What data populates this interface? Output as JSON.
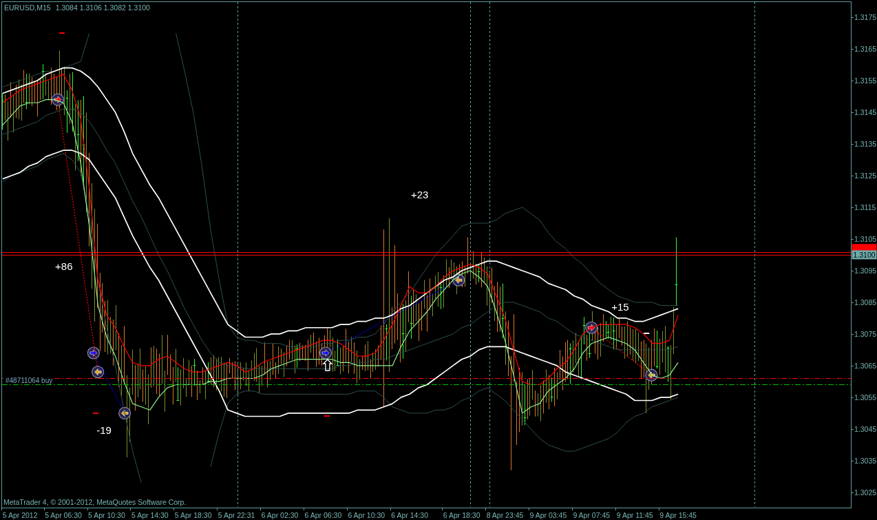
{
  "chart": {
    "symbol": "EURUSD,M15",
    "quotes": "1.3084 1.3106 1.3082 1.3100",
    "price_tag": "1.3100",
    "copyright": "MetaTrader 4, © 2001-2012, MetaQuotes Software Corp.",
    "chart_data": {
      "type": "line",
      "categories": [
        null,
        null,
        "5 Apr 2012",
        null,
        null,
        null,
        null,
        "5 Apr 06:30",
        null,
        null,
        null,
        null,
        "5 Apr 10:30",
        null,
        null,
        null,
        null,
        "5 Apr 14:30",
        null,
        null,
        null,
        null,
        "5 Apr 18:30",
        null,
        null,
        null,
        null,
        "5 Apr 22:31",
        null,
        null,
        null,
        null,
        "6 Apr 02:30",
        null,
        null,
        null,
        null,
        "6 Apr 06:30",
        null,
        null,
        null,
        null,
        "6 Apr 10:30",
        null,
        null,
        null,
        null,
        "6 Apr 14:30",
        null,
        null,
        null,
        null,
        null,
        "6 Apr 18:30",
        null,
        null,
        null,
        null,
        "8 Apr 23:45",
        null,
        null,
        null,
        null,
        "9 Apr 03:45",
        null,
        null,
        null,
        null,
        "9 Apr 07:45",
        null,
        null,
        null,
        null,
        "9 Apr 11:45",
        null,
        null,
        null,
        null,
        "9 Apr 15:45"
      ],
      "ylim": [
        1.30204,
        1.31798
      ],
      "yticks": [
        {
          "value": 1.3175,
          "label": "1.3175"
        },
        {
          "value": 1.3165,
          "label": "1.3165"
        },
        {
          "value": 1.3155,
          "label": "1.3155"
        },
        {
          "value": 1.3145,
          "label": "1.3145"
        },
        {
          "value": 1.3135,
          "label": "1.3135"
        },
        {
          "value": 1.3125,
          "label": "1.3125"
        },
        {
          "value": 1.3115,
          "label": "1.3115"
        },
        {
          "value": 1.3105,
          "label": "1.3105"
        },
        {
          "value": 1.3095,
          "label": "1.3095"
        },
        {
          "value": 1.3085,
          "label": "1.3085"
        },
        {
          "value": 1.3075,
          "label": "1.3075"
        },
        {
          "value": 1.3065,
          "label": "1.3065"
        },
        {
          "value": 1.3055,
          "label": "1.3055"
        },
        {
          "value": 1.3045,
          "label": "1.3045"
        },
        {
          "value": 1.3035,
          "label": "1.3035"
        },
        {
          "value": 1.3025,
          "label": "1.3025"
        }
      ],
      "series": [
        {
          "color": "#2f4f4f",
          "values": [
            1.3153,
            1.3154,
            1.3155,
            1.3156,
            1.3157,
            1.3158,
            1.3158,
            1.3159,
            1.316,
            1.3161,
            1.317,
            null,
            null,
            null,
            null,
            null,
            null,
            null,
            null,
            null,
            1.317,
            1.3158,
            1.3145,
            1.3128,
            1.3108,
            1.3092,
            1.3078,
            1.3074,
            1.3073,
            1.3073,
            1.3072,
            1.3072,
            1.3072,
            1.3071,
            1.3071,
            1.3071,
            1.3071,
            1.3072,
            1.3072,
            1.3073,
            1.3073,
            1.3074,
            1.3074,
            1.3075,
            1.3078,
            1.3082,
            1.3085,
            1.3088,
            1.3092,
            1.3096,
            1.31,
            1.3103,
            1.3106,
            1.3109,
            1.311,
            1.311,
            1.311,
            1.3111,
            1.3113,
            1.3114,
            1.3115,
            1.3113,
            1.3111,
            1.3107,
            1.3104,
            1.3102,
            1.3099,
            1.3097,
            1.3094,
            1.3091,
            1.3089,
            1.3087,
            1.3086,
            1.3085,
            1.3085,
            1.3085,
            1.3084,
            1.3084,
            1.3084
          ]
        },
        {
          "color": "#2f4f4f",
          "values": [
            1.3138,
            1.3139,
            1.314,
            1.3141,
            1.3142,
            1.3144,
            1.3145,
            1.3146,
            1.3146,
            1.3145,
            1.3142,
            1.3138,
            1.3133,
            1.3129,
            1.3123,
            1.3117,
            1.3112,
            1.3106,
            1.31,
            1.3095,
            1.3089,
            1.3083,
            1.3078,
            1.3073,
            1.3069,
            1.3066,
            1.3065,
            1.3065,
            1.3064,
            1.3064,
            1.3064,
            1.3064,
            1.3064,
            1.3064,
            1.3064,
            1.3064,
            1.3064,
            1.3064,
            1.3064,
            1.3065,
            1.3065,
            1.3066,
            1.3066,
            1.3067,
            1.3067,
            1.3068,
            1.3069,
            1.307,
            1.3071,
            1.3072,
            1.3073,
            1.3074,
            1.3075,
            1.3077,
            1.3078,
            1.308,
            1.3082,
            1.3084,
            1.3085,
            1.3085,
            1.3084,
            1.3083,
            1.3082,
            1.308,
            1.3079,
            1.3077,
            1.3075,
            1.3074,
            1.3073,
            1.3072,
            1.3071,
            1.307,
            1.307,
            1.307,
            1.307,
            1.307,
            1.307,
            1.307,
            1.3071
          ]
        },
        {
          "color": "#2f4f4f",
          "values": [
            1.3123,
            1.3125,
            1.3126,
            1.3127,
            1.3128,
            1.313,
            1.3131,
            1.3132,
            1.313,
            1.3126,
            1.3112,
            1.3092,
            1.3077,
            1.3065,
            1.3051,
            1.3038,
            1.3028,
            null,
            null,
            null,
            null,
            null,
            null,
            null,
            1.3033,
            1.3044,
            1.3053,
            1.3056,
            1.3057,
            1.3057,
            1.3056,
            1.3056,
            1.3056,
            1.3056,
            1.3056,
            1.3056,
            1.3056,
            1.3056,
            1.3056,
            1.3056,
            1.3056,
            1.3057,
            1.3057,
            1.3057,
            1.3055,
            1.3052,
            1.3051,
            1.305,
            1.305,
            1.305,
            1.3051,
            1.3051,
            1.3052,
            1.3054,
            1.3055,
            1.3057,
            1.3058,
            1.3056,
            1.3054,
            1.3051,
            1.3048,
            1.3045,
            1.3042,
            1.304,
            1.3039,
            1.3038,
            1.3038,
            1.3039,
            1.304,
            1.3041,
            1.3042,
            1.3044,
            1.3047,
            1.3049,
            1.305,
            1.3052,
            1.3053,
            1.3054,
            1.3055
          ]
        },
        {
          "color": "#ffffff",
          "values": [
            1.3151,
            1.3152,
            1.3153,
            1.3154,
            1.3155,
            1.3157,
            1.3158,
            1.3159,
            1.3159,
            1.3158,
            1.3156,
            1.3153,
            1.3149,
            1.3145,
            1.3139,
            1.3132,
            1.3127,
            1.3122,
            1.3118,
            1.3113,
            1.3108,
            1.3103,
            1.3098,
            1.3093,
            1.3088,
            1.3083,
            1.3078,
            1.3076,
            1.3074,
            1.3074,
            1.3074,
            1.3075,
            1.3075,
            1.3076,
            1.3076,
            1.3077,
            1.3077,
            1.3077,
            1.3077,
            1.3078,
            1.3078,
            1.3079,
            1.3079,
            1.308,
            1.308,
            1.3081,
            1.3083,
            1.3084,
            1.3086,
            1.3088,
            1.309,
            1.3092,
            1.3093,
            1.3095,
            1.3096,
            1.3097,
            1.3098,
            1.3098,
            1.3097,
            1.3096,
            1.3095,
            1.3094,
            1.3093,
            1.3091,
            1.309,
            1.3089,
            1.3087,
            1.3086,
            1.3084,
            1.3083,
            1.3082,
            1.308,
            1.308,
            1.3079,
            1.3079,
            1.308,
            1.3081,
            1.3082,
            1.3083
          ]
        },
        {
          "color": "#ffffff",
          "values": [
            1.3124,
            1.3125,
            1.3126,
            1.3128,
            1.3129,
            1.3131,
            1.3132,
            1.3133,
            1.3133,
            1.3132,
            1.313,
            1.3126,
            1.3122,
            1.3118,
            1.3112,
            1.3106,
            1.3101,
            1.3096,
            1.3092,
            1.3087,
            1.3082,
            1.3077,
            1.3072,
            1.3067,
            1.3062,
            1.3057,
            1.3051,
            1.305,
            1.3049,
            1.3049,
            1.3049,
            1.3049,
            1.3049,
            1.305,
            1.305,
            1.305,
            1.305,
            1.305,
            1.305,
            1.305,
            1.305,
            1.3051,
            1.3051,
            1.3051,
            1.3052,
            1.3053,
            1.3055,
            1.3056,
            1.3058,
            1.3059,
            1.3061,
            1.3063,
            1.3065,
            1.3067,
            1.3068,
            1.307,
            1.3071,
            1.3071,
            1.3071,
            1.307,
            1.3069,
            1.3068,
            1.3067,
            1.3066,
            1.3065,
            1.3063,
            1.3062,
            1.3061,
            1.306,
            1.3059,
            1.3058,
            1.3057,
            1.3056,
            1.3054,
            1.3054,
            1.3054,
            1.3055,
            1.3055,
            1.3056
          ]
        },
        {
          "color": "#ff0000",
          "values": [
            1.3148,
            1.315,
            1.3152,
            1.3153,
            1.3154,
            1.3155,
            1.3156,
            1.3157,
            1.3152,
            1.3143,
            1.3121,
            1.3092,
            1.3081,
            1.3077,
            1.3071,
            1.3066,
            1.3065,
            1.3065,
            1.3067,
            1.3068,
            1.3066,
            1.3064,
            1.3063,
            1.3063,
            1.3064,
            1.3065,
            1.3066,
            1.3065,
            1.3063,
            1.3064,
            1.3066,
            1.3067,
            1.3068,
            1.3069,
            1.307,
            1.3071,
            1.3072,
            1.3073,
            1.3073,
            1.3072,
            1.307,
            1.3068,
            1.3068,
            1.3069,
            1.3073,
            1.3078,
            1.3084,
            1.309,
            1.3088,
            1.3088,
            1.309,
            1.3093,
            1.3095,
            1.3096,
            1.3097,
            1.3096,
            1.3094,
            1.3087,
            1.308,
            1.307,
            1.306,
            1.3059,
            1.3059,
            1.3061,
            1.3064,
            1.3066,
            1.307,
            1.3075,
            1.3077,
            1.3078,
            1.3078,
            1.3078,
            1.3078,
            1.3077,
            1.3075,
            1.3072,
            1.3072,
            1.3073,
            1.3081
          ]
        },
        {
          "color": "#90ee90",
          "values": [
            1.3141,
            1.3144,
            1.3147,
            1.3148,
            1.3148,
            1.3149,
            1.3149,
            1.3148,
            1.3142,
            1.3129,
            1.3109,
            1.3084,
            1.3074,
            1.3068,
            1.306,
            1.3053,
            1.3052,
            1.3051,
            1.3055,
            1.3058,
            1.3059,
            1.3059,
            1.3059,
            1.3059,
            1.306,
            1.306,
            1.3061,
            1.3061,
            1.3061,
            1.3061,
            1.3062,
            1.3064,
            1.3065,
            1.3066,
            1.3067,
            1.3067,
            1.3067,
            1.3067,
            1.3067,
            1.3066,
            1.3066,
            1.3065,
            1.3065,
            1.3065,
            1.3065,
            1.3065,
            1.3071,
            1.3076,
            1.3079,
            1.3082,
            1.3086,
            1.3089,
            1.3092,
            1.3094,
            1.3095,
            1.3093,
            1.309,
            1.3082,
            1.3073,
            1.3062,
            1.305,
            1.3052,
            1.3053,
            1.3057,
            1.3059,
            1.3061,
            1.3064,
            1.3069,
            1.3072,
            1.3073,
            1.3074,
            1.3073,
            1.3072,
            1.307,
            1.3066,
            1.3062,
            1.3061,
            1.3062,
            1.3066
          ]
        }
      ],
      "annotations": [
        "+86",
        "-19",
        "+23",
        "+15"
      ],
      "ref_lines": [
        {
          "axis": "y",
          "value": 1.31009,
          "color": "#ff0000"
        },
        {
          "axis": "y",
          "value": 1.31,
          "color": "#ff0000"
        },
        {
          "axis": "y",
          "value": 1.30611,
          "color": "#ff0000"
        },
        {
          "axis": "y",
          "value": 1.3059,
          "color": "#00c000",
          "label": "#48711064 buy"
        }
      ]
    }
  }
}
